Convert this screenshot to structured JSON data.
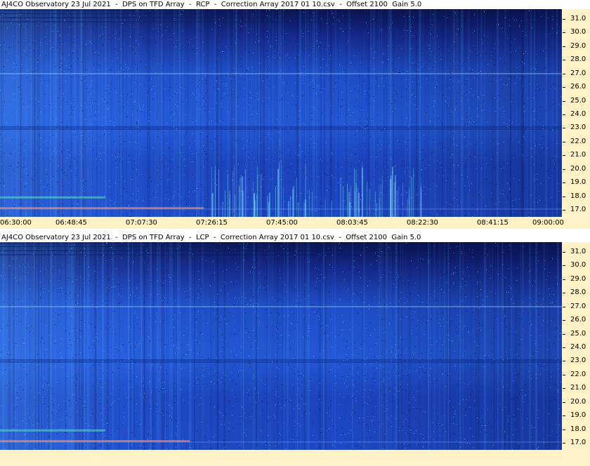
{
  "chart_data": [
    {
      "type": "heatmap",
      "title": "AJ4CO Observatory 23 Jul 2021  -  DPS on TFD Array  -  RCP  -  Correction Array 2017 01 10.csv  -  Offset 2100  Gain 5.0",
      "polarization": "RCP",
      "x_tick_labels": [
        "06:30:00",
        "06:48:45",
        "07:07:30",
        "07:26:15",
        "07:45:00",
        "08:03:45",
        "08:22:30",
        "08:41:15",
        "09:00:00"
      ],
      "y_tick_labels": [
        "31.0",
        "30.0",
        "29.0",
        "28.0",
        "27.0",
        "26.0",
        "25.0",
        "24.0",
        "23.0",
        "22.0",
        "21.0",
        "20.0",
        "19.0",
        "18.0",
        "17.0"
      ],
      "y_ticks": [
        31.0,
        30.0,
        29.0,
        28.0,
        27.0,
        26.0,
        25.0,
        24.0,
        23.0,
        22.0,
        21.0,
        20.0,
        19.0,
        18.0,
        17.0
      ],
      "ylim": [
        16.5,
        31.7
      ],
      "xlim": [
        "06:30:00",
        "09:00:00"
      ],
      "colormap": [
        "#0a1450",
        "#1e46c4",
        "#3a8cff",
        "#7fd6ff"
      ]
    },
    {
      "type": "heatmap",
      "title": "AJ4CO Observatory 23 Jul 2021  -  DPS on TFD Array  -  LCP  -  Correction Array 2017 01 10.csv  -  Offset 2100  Gain 5.0",
      "polarization": "LCP",
      "y_tick_labels": [
        "31.0",
        "30.0",
        "29.0",
        "28.0",
        "27.0",
        "26.0",
        "25.0",
        "24.0",
        "23.0",
        "22.0",
        "21.0",
        "20.0",
        "19.0",
        "18.0",
        "17.0"
      ],
      "y_ticks": [
        31.0,
        30.0,
        29.0,
        28.0,
        27.0,
        26.0,
        25.0,
        24.0,
        23.0,
        22.0,
        21.0,
        20.0,
        19.0,
        18.0,
        17.0
      ],
      "ylim": [
        16.5,
        31.7
      ],
      "xlim": [
        "06:30:00",
        "09:00:00"
      ],
      "colormap": [
        "#0a1450",
        "#1e46c4",
        "#3a8cff",
        "#7fd6ff"
      ]
    }
  ],
  "colors": {
    "axis_background": "#fff2c6",
    "title_background": "#ffffff"
  }
}
